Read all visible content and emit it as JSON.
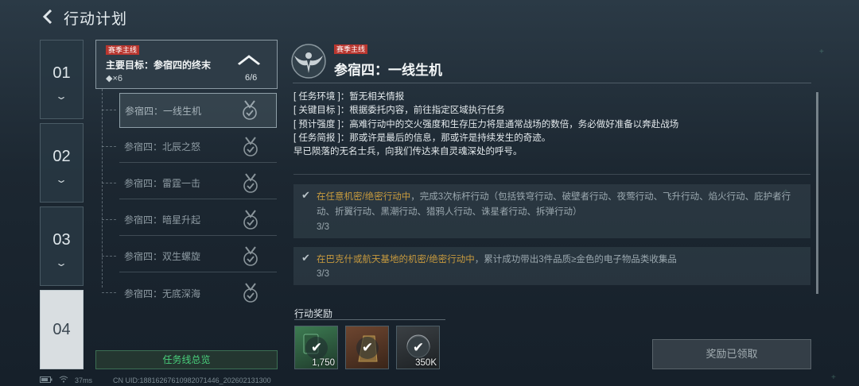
{
  "header": {
    "title": "行动计划"
  },
  "chapters": [
    {
      "label": "01",
      "active": false
    },
    {
      "label": "02",
      "active": false
    },
    {
      "label": "03",
      "active": false
    },
    {
      "label": "04",
      "active": true
    }
  ],
  "main_target": {
    "tag": "赛季主线",
    "goal": "主要目标：参宿四的终末",
    "count": "◆×6",
    "progress": "6/6"
  },
  "missions": [
    {
      "label": "参宿四：一线生机",
      "active": true
    },
    {
      "label": "参宿四：北辰之怒",
      "active": false
    },
    {
      "label": "参宿四：雷霆一击",
      "active": false
    },
    {
      "label": "参宿四：暗星升起",
      "active": false
    },
    {
      "label": "参宿四：双生螺旋",
      "active": false
    },
    {
      "label": "参宿四：无底深海",
      "active": false
    }
  ],
  "overview_button": "任务线总览",
  "detail": {
    "tag": "赛季主线",
    "title": "参宿四：一线生机",
    "info": [
      {
        "key": "[ 任务环境 ]",
        "value": "：暂无相关情报"
      },
      {
        "key": "[ 关键目标 ]",
        "value": "：根据委托内容，前往指定区域执行任务"
      },
      {
        "key": "[ 预计强度 ]",
        "value": "：高难行动中的交火强度和生存压力将是通常战场的数倍，务必做好准备以奔赴战场"
      },
      {
        "key": "[ 任务简报 ]",
        "value": "：那或许是最后的信息，那或许是持续发生的奇迹。"
      }
    ],
    "flavor": "早已陨落的无名士兵，向我们传达来自灵魂深处的呼号。",
    "objectives": [
      {
        "highlight": "在任意机密/绝密行动中",
        "text": "，完成3次标杆行动（包括铁穹行动、破壁者行动、夜莺行动、飞升行动、焰火行动、庇护者行动、折翼行动、黑潮行动、猎鸦人行动、诛星者行动、拆弹行动）",
        "count": "3/3"
      },
      {
        "highlight": "在巴克什或航天基地的机密/绝密行动中",
        "text": "，累计成功带出3件品质≥金色的电子物品类收集品",
        "count": "3/3"
      }
    ]
  },
  "rewards": {
    "label": "行动奖励",
    "items": [
      {
        "amount": "1,750",
        "icon": "green-currency-icon",
        "color": "#2f6b44"
      },
      {
        "amount": "",
        "icon": "gold-bar-icon",
        "color": "#5a3a26"
      },
      {
        "amount": "350K",
        "icon": "coin-icon",
        "color": "#2f3336"
      }
    ],
    "claim_label": "奖励已领取"
  },
  "status_bar": {
    "ping": "37ms",
    "uid": "CN UID:18816267610982071446_202602131300"
  },
  "colors": {
    "accent_green": "#49d07c",
    "tag_red": "#b8362f",
    "highlight_gold": "#c79a3e"
  }
}
